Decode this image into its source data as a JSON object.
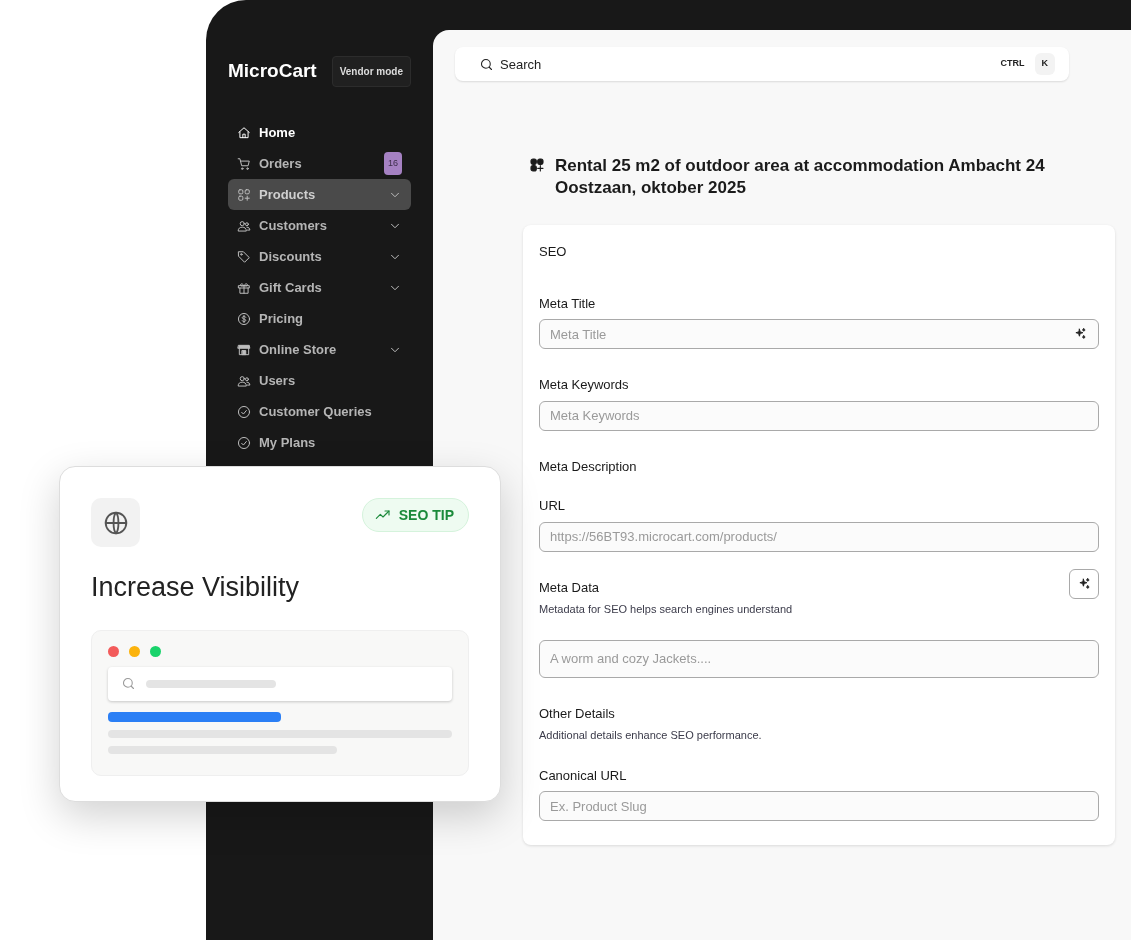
{
  "brand": {
    "name": "MicroCart",
    "mode_badge": "Vendor mode"
  },
  "sidebar": {
    "items": [
      {
        "label": "Home",
        "highlighted": true,
        "selected": false,
        "expandable": false
      },
      {
        "label": "Orders",
        "highlighted": false,
        "selected": false,
        "expandable": false,
        "badge": "16"
      },
      {
        "label": "Products",
        "highlighted": false,
        "selected": true,
        "expandable": true
      },
      {
        "label": "Customers",
        "highlighted": false,
        "selected": false,
        "expandable": true
      },
      {
        "label": "Discounts",
        "highlighted": false,
        "selected": false,
        "expandable": true
      },
      {
        "label": "Gift Cards",
        "highlighted": false,
        "selected": false,
        "expandable": true
      },
      {
        "label": "Pricing",
        "highlighted": false,
        "selected": false,
        "expandable": false
      },
      {
        "label": "Online Store",
        "highlighted": false,
        "selected": false,
        "expandable": true
      },
      {
        "label": "Users",
        "highlighted": false,
        "selected": false,
        "expandable": false
      },
      {
        "label": "Customer Queries",
        "highlighted": false,
        "selected": false,
        "expandable": false
      },
      {
        "label": "My Plans",
        "highlighted": false,
        "selected": false,
        "expandable": false
      }
    ]
  },
  "search": {
    "placeholder": "Search",
    "shortcut": [
      "CTRL",
      "K"
    ]
  },
  "page_title": "Rental 25 m2 of outdoor area at accommodation Ambacht 24 Oostzaan, oktober 2025",
  "seo_card": {
    "title": "SEO",
    "fields": [
      {
        "kind": "input",
        "label": "Meta Title",
        "placeholder": "Meta Title",
        "ai_button": true
      },
      {
        "kind": "input",
        "label": "Meta Keywords",
        "placeholder": "Meta Keywords"
      },
      {
        "kind": "label",
        "label": "Meta Description"
      },
      {
        "kind": "input",
        "label": "URL",
        "placeholder": "https://56BT93.microcart.com/products/"
      },
      {
        "kind": "group",
        "label": "Meta Data",
        "description": "Metadata for SEO helps search engines understand",
        "ai_button": true
      },
      {
        "kind": "input",
        "placeholder": "A worm and cozy Jackets...."
      },
      {
        "kind": "group",
        "label": "Other Details",
        "description": "Additional details enhance SEO performance."
      },
      {
        "kind": "input",
        "label": "Canonical URL",
        "placeholder": "Ex. Product Slug"
      }
    ]
  },
  "tip_card": {
    "badge": "SEO TIP",
    "title": "Increase Visibility"
  }
}
